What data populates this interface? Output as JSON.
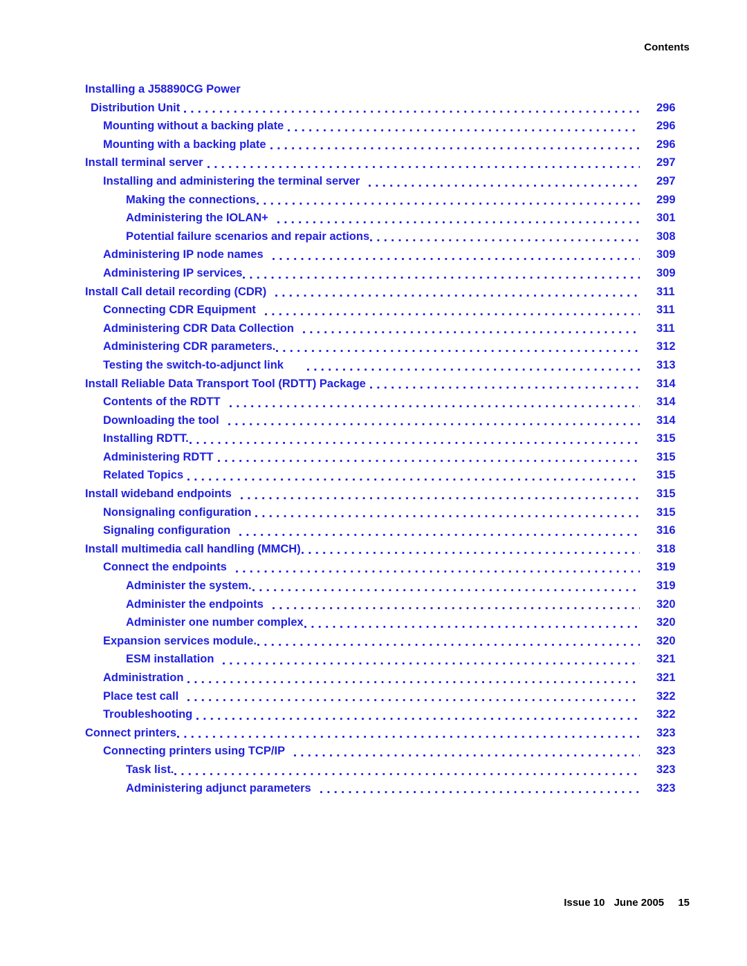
{
  "header": {
    "running_head": "Contents"
  },
  "toc": {
    "entries": [
      {
        "title": "Installing a J58890CG Power",
        "page": "",
        "level": 0,
        "leaders": false,
        "gap": "none"
      },
      {
        "title": "Distribution Unit",
        "page": "296",
        "level": "0b",
        "leaders": true,
        "gap": "sm"
      },
      {
        "title": "Mounting without a backing plate",
        "page": "296",
        "level": 1,
        "leaders": true,
        "gap": "sm"
      },
      {
        "title": "Mounting with a backing plate",
        "page": "296",
        "level": 1,
        "leaders": true,
        "gap": "sm"
      },
      {
        "title": "Install terminal server",
        "page": "297",
        "level": 0,
        "leaders": true,
        "gap": "sm"
      },
      {
        "title": "Installing and administering the terminal server",
        "page": "297",
        "level": 1,
        "leaders": true,
        "gap": "med"
      },
      {
        "title": "Making the connections",
        "page": "299",
        "level": 2,
        "leaders": true,
        "gap": "none"
      },
      {
        "title": "Administering the IOLAN+",
        "page": "301",
        "level": 2,
        "leaders": true,
        "gap": "med"
      },
      {
        "title": "Potential failure scenarios and repair actions",
        "page": "308",
        "level": 2,
        "leaders": true,
        "gap": "none"
      },
      {
        "title": "Administering IP node names",
        "page": "309",
        "level": 1,
        "leaders": true,
        "gap": "med"
      },
      {
        "title": "Administering IP services",
        "page": "309",
        "level": 1,
        "leaders": true,
        "gap": "none"
      },
      {
        "title": "Install Call detail recording (CDR)",
        "page": "311",
        "level": 0,
        "leaders": true,
        "gap": "med"
      },
      {
        "title": "Connecting CDR Equipment",
        "page": "311",
        "level": 1,
        "leaders": true,
        "gap": "med"
      },
      {
        "title": "Administering CDR Data Collection",
        "page": "311",
        "level": 1,
        "leaders": true,
        "gap": "med"
      },
      {
        "title": "Administering CDR parameters.",
        "page": "312",
        "level": 1,
        "leaders": true,
        "gap": "none"
      },
      {
        "title": "Testing the switch-to-adjunct link",
        "page": "313",
        "level": 1,
        "leaders": true,
        "gap": "lg"
      },
      {
        "title": "Install Reliable Data Transport Tool (RDTT) Package",
        "page": "314",
        "level": 0,
        "leaders": true,
        "gap": "sm"
      },
      {
        "title": "Contents of the RDTT",
        "page": "314",
        "level": 1,
        "leaders": true,
        "gap": "med"
      },
      {
        "title": "Downloading the tool",
        "page": "314",
        "level": 1,
        "leaders": true,
        "gap": "med"
      },
      {
        "title": "Installing RDTT.",
        "page": "315",
        "level": 1,
        "leaders": true,
        "gap": "none"
      },
      {
        "title": "Administering RDTT",
        "page": "315",
        "level": 1,
        "leaders": true,
        "gap": "sm"
      },
      {
        "title": "Related Topics",
        "page": "315",
        "level": 1,
        "leaders": true,
        "gap": "sm"
      },
      {
        "title": "Install wideband endpoints",
        "page": "315",
        "level": 0,
        "leaders": true,
        "gap": "med"
      },
      {
        "title": "Nonsignaling configuration",
        "page": "315",
        "level": 1,
        "leaders": true,
        "gap": "sm"
      },
      {
        "title": "Signaling configuration",
        "page": "316",
        "level": 1,
        "leaders": true,
        "gap": "med"
      },
      {
        "title": "Install multimedia call handling (MMCH)",
        "page": "318",
        "level": 0,
        "leaders": true,
        "gap": "none"
      },
      {
        "title": "Connect the endpoints",
        "page": "319",
        "level": 1,
        "leaders": true,
        "gap": "med"
      },
      {
        "title": "Administer the system.",
        "page": "319",
        "level": 2,
        "leaders": true,
        "gap": "none"
      },
      {
        "title": "Administer the endpoints",
        "page": "320",
        "level": 2,
        "leaders": true,
        "gap": "med"
      },
      {
        "title": "Administer one number complex",
        "page": "320",
        "level": 2,
        "leaders": true,
        "gap": "none"
      },
      {
        "title": "Expansion services module.",
        "page": "320",
        "level": 1,
        "leaders": true,
        "gap": "none"
      },
      {
        "title": "ESM installation",
        "page": "321",
        "level": 2,
        "leaders": true,
        "gap": "med"
      },
      {
        "title": "Administration",
        "page": "321",
        "level": 1,
        "leaders": true,
        "gap": "sm"
      },
      {
        "title": "Place test call",
        "page": "322",
        "level": 1,
        "leaders": true,
        "gap": "med"
      },
      {
        "title": "Troubleshooting",
        "page": "322",
        "level": 1,
        "leaders": true,
        "gap": "sm"
      },
      {
        "title": "Connect printers",
        "page": "323",
        "level": 0,
        "leaders": true,
        "gap": "none"
      },
      {
        "title": "Connecting printers using TCP/IP",
        "page": "323",
        "level": 1,
        "leaders": true,
        "gap": "med"
      },
      {
        "title": "Task list.",
        "page": "323",
        "level": 2,
        "leaders": true,
        "gap": "none"
      },
      {
        "title": "Administering adjunct parameters",
        "page": "323",
        "level": 2,
        "leaders": true,
        "gap": "med"
      }
    ]
  },
  "footer": {
    "issue": "Issue 10",
    "date": "June 2005",
    "folio": "15"
  },
  "colors": {
    "link_blue": "#2020e0",
    "text_black": "#000000",
    "background": "#ffffff"
  }
}
